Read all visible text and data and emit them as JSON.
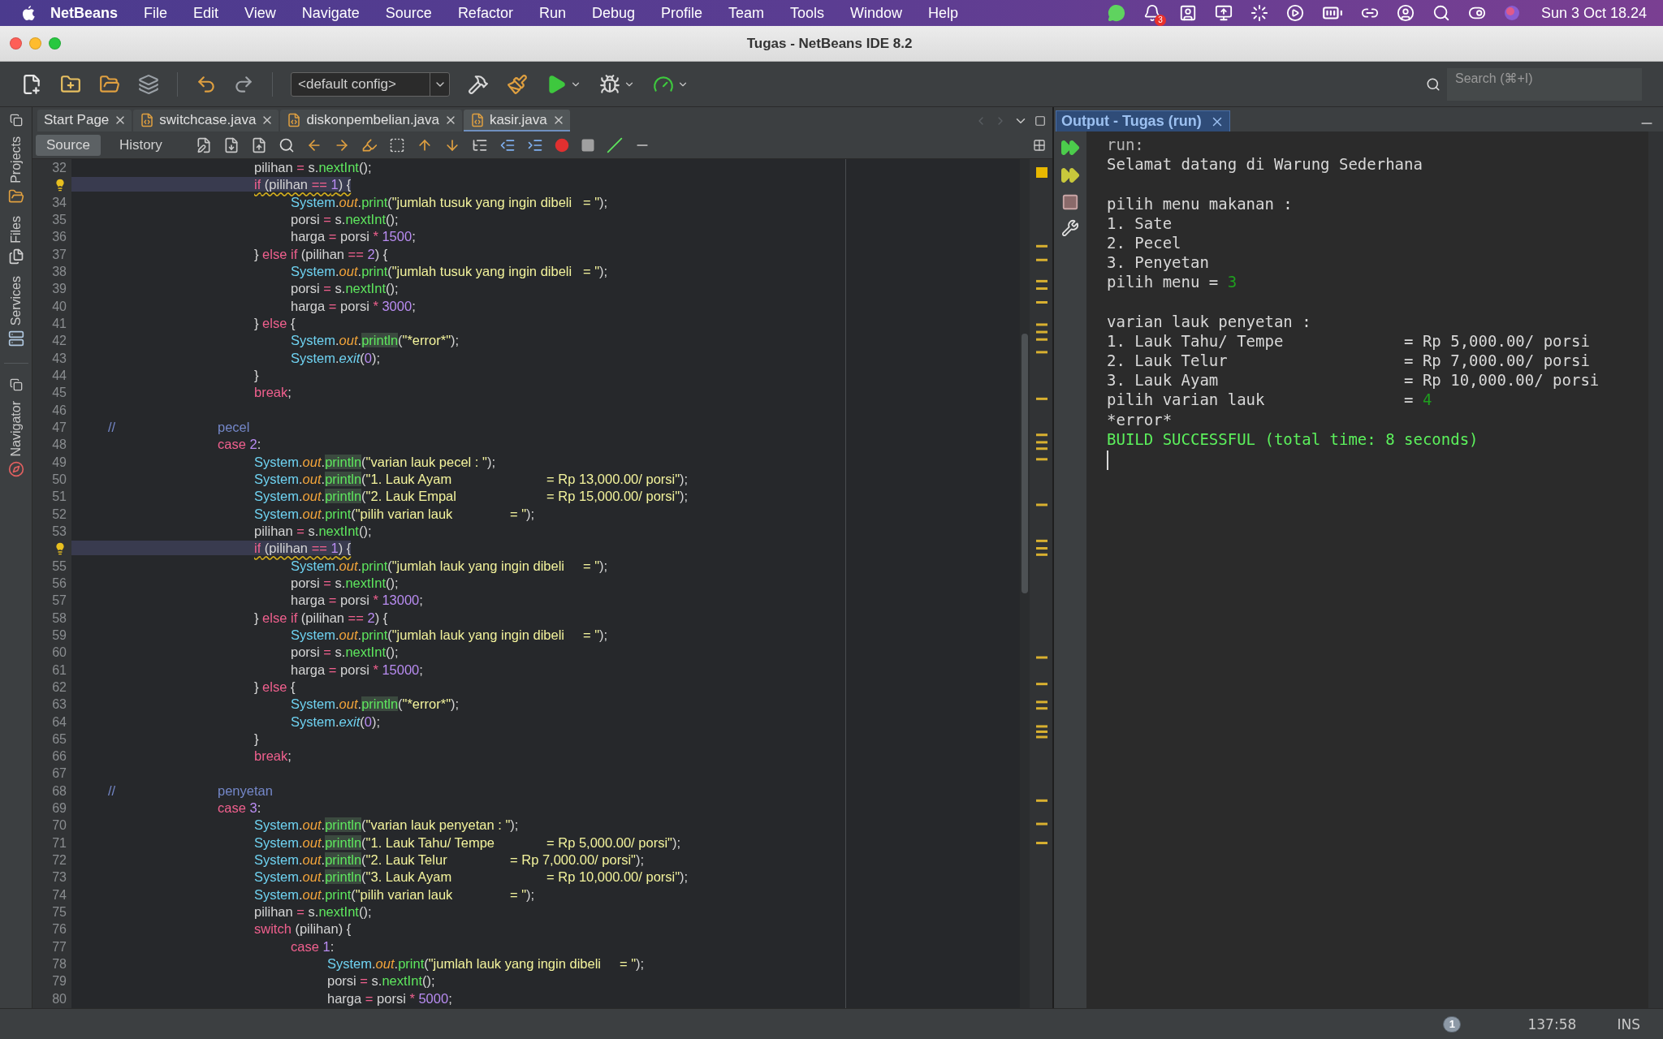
{
  "menubar": {
    "app": "NetBeans",
    "menus": [
      "File",
      "Edit",
      "View",
      "Navigate",
      "Source",
      "Refactor",
      "Run",
      "Debug",
      "Profile",
      "Team",
      "Tools",
      "Window",
      "Help"
    ],
    "badge": "3",
    "clock": "Sun 3 Oct  18.24"
  },
  "window": {
    "title": "Tugas - NetBeans IDE 8.2"
  },
  "toolbar": {
    "config": "<default config>",
    "search": {
      "placeholder": "Search (⌘+I)"
    }
  },
  "side_tabs_top": [
    {
      "label": "Projects",
      "kind": "projects"
    },
    {
      "label": "Files",
      "kind": "files"
    },
    {
      "label": "Services",
      "kind": "services"
    }
  ],
  "side_tabs_bottom": [
    {
      "label": "Navigator",
      "kind": "navigator"
    }
  ],
  "editor": {
    "tabs": [
      {
        "label": "Start Page",
        "kind": "page",
        "selected": false
      },
      {
        "label": "switchcase.java",
        "kind": "java",
        "selected": false
      },
      {
        "label": "diskonpembelian.java",
        "kind": "java",
        "selected": false
      },
      {
        "label": "kasir.java",
        "kind": "java",
        "selected": true
      }
    ],
    "view_tabs": [
      {
        "label": "Source",
        "selected": true
      },
      {
        "label": "History",
        "selected": false
      }
    ],
    "lines": [
      {
        "number": "32",
        "warning": false,
        "tokens": [
          {
            "kind": "p",
            "text": "\t\t\t\t\tpilihan "
          },
          {
            "kind": "op",
            "text": "= "
          },
          {
            "kind": "p",
            "text": "s."
          },
          {
            "kind": "m",
            "text": "nextInt"
          },
          {
            "kind": "p",
            "text": "();"
          }
        ]
      },
      {
        "warning": true,
        "tokens": [
          {
            "kind": "wkw",
            "text": "\t\t\t\t\tif"
          },
          {
            "kind": "wp",
            "text": " (pilihan "
          },
          {
            "kind": "wop",
            "text": "== "
          },
          {
            "kind": "wnum",
            "text": "1"
          },
          {
            "kind": "wp",
            "text": ") {"
          }
        ]
      },
      {
        "number": "34",
        "warning": false,
        "tokens": [
          {
            "kind": "sys",
            "text": "\t\t\t\t\t\tSystem"
          },
          {
            "kind": "p",
            "text": "."
          },
          {
            "kind": "field",
            "text": "out"
          },
          {
            "kind": "p",
            "text": "."
          },
          {
            "kind": "m",
            "text": "print"
          },
          {
            "kind": "p",
            "text": "("
          },
          {
            "kind": "str",
            "text": "\"jumlah tusuk yang ingin dibeli\t= \""
          },
          {
            "kind": "p",
            "text": ");"
          }
        ]
      },
      {
        "number": "35",
        "warning": false,
        "tokens": [
          {
            "kind": "p",
            "text": "\t\t\t\t\t\tporsi "
          },
          {
            "kind": "op",
            "text": "= "
          },
          {
            "kind": "p",
            "text": "s."
          },
          {
            "kind": "m",
            "text": "nextInt"
          },
          {
            "kind": "p",
            "text": "();"
          }
        ]
      },
      {
        "number": "36",
        "warning": false,
        "tokens": [
          {
            "kind": "p",
            "text": "\t\t\t\t\t\tharga "
          },
          {
            "kind": "op",
            "text": "= "
          },
          {
            "kind": "p",
            "text": "porsi "
          },
          {
            "kind": "op",
            "text": "* "
          },
          {
            "kind": "num",
            "text": "1500"
          },
          {
            "kind": "p",
            "text": ";"
          }
        ]
      },
      {
        "number": "37",
        "warning": false,
        "tokens": [
          {
            "kind": "p",
            "text": "\t\t\t\t\t} "
          },
          {
            "kind": "kw",
            "text": "else if"
          },
          {
            "kind": "p",
            "text": " (pilihan "
          },
          {
            "kind": "op",
            "text": "== "
          },
          {
            "kind": "num",
            "text": "2"
          },
          {
            "kind": "p",
            "text": ") {"
          }
        ]
      },
      {
        "number": "38",
        "warning": false,
        "tokens": [
          {
            "kind": "sys",
            "text": "\t\t\t\t\t\tSystem"
          },
          {
            "kind": "p",
            "text": "."
          },
          {
            "kind": "field",
            "text": "out"
          },
          {
            "kind": "p",
            "text": "."
          },
          {
            "kind": "m",
            "text": "print"
          },
          {
            "kind": "p",
            "text": "("
          },
          {
            "kind": "str",
            "text": "\"jumlah tusuk yang ingin dibeli\t= \""
          },
          {
            "kind": "p",
            "text": ");"
          }
        ]
      },
      {
        "number": "39",
        "warning": false,
        "tokens": [
          {
            "kind": "p",
            "text": "\t\t\t\t\t\tporsi "
          },
          {
            "kind": "op",
            "text": "= "
          },
          {
            "kind": "p",
            "text": "s."
          },
          {
            "kind": "m",
            "text": "nextInt"
          },
          {
            "kind": "p",
            "text": "();"
          }
        ]
      },
      {
        "number": "40",
        "warning": false,
        "tokens": [
          {
            "kind": "p",
            "text": "\t\t\t\t\t\tharga "
          },
          {
            "kind": "op",
            "text": "= "
          },
          {
            "kind": "p",
            "text": "porsi "
          },
          {
            "kind": "op",
            "text": "* "
          },
          {
            "kind": "num",
            "text": "3000"
          },
          {
            "kind": "p",
            "text": ";"
          }
        ]
      },
      {
        "number": "41",
        "warning": false,
        "tokens": [
          {
            "kind": "p",
            "text": "\t\t\t\t\t} "
          },
          {
            "kind": "kw",
            "text": "else"
          },
          {
            "kind": "p",
            "text": " {"
          }
        ]
      },
      {
        "number": "42",
        "warning": false,
        "tokens": [
          {
            "kind": "sys",
            "text": "\t\t\t\t\t\tSystem"
          },
          {
            "kind": "p",
            "text": "."
          },
          {
            "kind": "field",
            "text": "out"
          },
          {
            "kind": "p",
            "text": "."
          },
          {
            "kind": "hl",
            "text": "println"
          },
          {
            "kind": "p",
            "text": "("
          },
          {
            "kind": "str",
            "text": "\"*error*\""
          },
          {
            "kind": "p",
            "text": ");"
          }
        ]
      },
      {
        "number": "43",
        "warning": false,
        "tokens": [
          {
            "kind": "sys",
            "text": "\t\t\t\t\t\tSystem"
          },
          {
            "kind": "p",
            "text": "."
          },
          {
            "kind": "static",
            "text": "exit"
          },
          {
            "kind": "p",
            "text": "("
          },
          {
            "kind": "num",
            "text": "0"
          },
          {
            "kind": "p",
            "text": ");"
          }
        ]
      },
      {
        "number": "44",
        "warning": false,
        "tokens": [
          {
            "kind": "p",
            "text": "\t\t\t\t\t}"
          }
        ]
      },
      {
        "number": "45",
        "warning": false,
        "tokens": [
          {
            "kind": "kw",
            "text": "\t\t\t\t\tbreak"
          },
          {
            "kind": "p",
            "text": ";"
          }
        ]
      },
      {
        "number": "46",
        "warning": false
      },
      {
        "number": "47",
        "warning": false,
        "tokens": [
          {
            "kind": "cm",
            "text": "\t//\t\t\tpecel"
          }
        ]
      },
      {
        "number": "48",
        "warning": false,
        "tokens": [
          {
            "kind": "kw",
            "text": "\t\t\t\tcase "
          },
          {
            "kind": "num",
            "text": "2"
          },
          {
            "kind": "p",
            "text": ":"
          }
        ]
      },
      {
        "number": "49",
        "warning": false,
        "tokens": [
          {
            "kind": "sys",
            "text": "\t\t\t\t\tSystem"
          },
          {
            "kind": "p",
            "text": "."
          },
          {
            "kind": "field",
            "text": "out"
          },
          {
            "kind": "p",
            "text": "."
          },
          {
            "kind": "hl",
            "text": "println"
          },
          {
            "kind": "p",
            "text": "("
          },
          {
            "kind": "str",
            "text": "\"varian lauk pecel : \""
          },
          {
            "kind": "p",
            "text": ");"
          }
        ]
      },
      {
        "number": "50",
        "warning": false,
        "tokens": [
          {
            "kind": "sys",
            "text": "\t\t\t\t\tSystem"
          },
          {
            "kind": "p",
            "text": "."
          },
          {
            "kind": "field",
            "text": "out"
          },
          {
            "kind": "p",
            "text": "."
          },
          {
            "kind": "hl",
            "text": "println"
          },
          {
            "kind": "p",
            "text": "("
          },
          {
            "kind": "str",
            "text": "\"1. Lauk Ayam\t\t\t= Rp 13,000.00/ porsi\""
          },
          {
            "kind": "p",
            "text": ");"
          }
        ]
      },
      {
        "number": "51",
        "warning": false,
        "tokens": [
          {
            "kind": "sys",
            "text": "\t\t\t\t\tSystem"
          },
          {
            "kind": "p",
            "text": "."
          },
          {
            "kind": "field",
            "text": "out"
          },
          {
            "kind": "p",
            "text": "."
          },
          {
            "kind": "hl",
            "text": "println"
          },
          {
            "kind": "p",
            "text": "("
          },
          {
            "kind": "str",
            "text": "\"2. Lauk Empal\t\t\t= Rp 15,000.00/ porsi\""
          },
          {
            "kind": "p",
            "text": ");"
          }
        ]
      },
      {
        "number": "52",
        "warning": false,
        "tokens": [
          {
            "kind": "sys",
            "text": "\t\t\t\t\tSystem"
          },
          {
            "kind": "p",
            "text": "."
          },
          {
            "kind": "field",
            "text": "out"
          },
          {
            "kind": "p",
            "text": "."
          },
          {
            "kind": "m",
            "text": "print"
          },
          {
            "kind": "p",
            "text": "("
          },
          {
            "kind": "str",
            "text": "\"pilih varian lauk\t\t= \""
          },
          {
            "kind": "p",
            "text": ");"
          }
        ]
      },
      {
        "number": "53",
        "warning": false,
        "tokens": [
          {
            "kind": "p",
            "text": "\t\t\t\t\tpilihan "
          },
          {
            "kind": "op",
            "text": "= "
          },
          {
            "kind": "p",
            "text": "s."
          },
          {
            "kind": "m",
            "text": "nextInt"
          },
          {
            "kind": "p",
            "text": "();"
          }
        ]
      },
      {
        "warning": true,
        "tokens": [
          {
            "kind": "wkw",
            "text": "\t\t\t\t\tif"
          },
          {
            "kind": "wp",
            "text": " (pilihan "
          },
          {
            "kind": "wop",
            "text": "== "
          },
          {
            "kind": "wnum",
            "text": "1"
          },
          {
            "kind": "wp",
            "text": ") {"
          }
        ]
      },
      {
        "number": "55",
        "warning": false,
        "tokens": [
          {
            "kind": "sys",
            "text": "\t\t\t\t\t\tSystem"
          },
          {
            "kind": "p",
            "text": "."
          },
          {
            "kind": "field",
            "text": "out"
          },
          {
            "kind": "p",
            "text": "."
          },
          {
            "kind": "m",
            "text": "print"
          },
          {
            "kind": "p",
            "text": "("
          },
          {
            "kind": "str",
            "text": "\"jumlah lauk yang ingin dibeli\t= \""
          },
          {
            "kind": "p",
            "text": ");"
          }
        ]
      },
      {
        "number": "56",
        "warning": false,
        "tokens": [
          {
            "kind": "p",
            "text": "\t\t\t\t\t\tporsi "
          },
          {
            "kind": "op",
            "text": "= "
          },
          {
            "kind": "p",
            "text": "s."
          },
          {
            "kind": "m",
            "text": "nextInt"
          },
          {
            "kind": "p",
            "text": "();"
          }
        ]
      },
      {
        "number": "57",
        "warning": false,
        "tokens": [
          {
            "kind": "p",
            "text": "\t\t\t\t\t\tharga "
          },
          {
            "kind": "op",
            "text": "= "
          },
          {
            "kind": "p",
            "text": "porsi "
          },
          {
            "kind": "op",
            "text": "* "
          },
          {
            "kind": "num",
            "text": "13000"
          },
          {
            "kind": "p",
            "text": ";"
          }
        ]
      },
      {
        "number": "58",
        "warning": false,
        "tokens": [
          {
            "kind": "p",
            "text": "\t\t\t\t\t} "
          },
          {
            "kind": "kw",
            "text": "else if"
          },
          {
            "kind": "p",
            "text": " (pilihan "
          },
          {
            "kind": "op",
            "text": "== "
          },
          {
            "kind": "num",
            "text": "2"
          },
          {
            "kind": "p",
            "text": ") {"
          }
        ]
      },
      {
        "number": "59",
        "warning": false,
        "tokens": [
          {
            "kind": "sys",
            "text": "\t\t\t\t\t\tSystem"
          },
          {
            "kind": "p",
            "text": "."
          },
          {
            "kind": "field",
            "text": "out"
          },
          {
            "kind": "p",
            "text": "."
          },
          {
            "kind": "m",
            "text": "print"
          },
          {
            "kind": "p",
            "text": "("
          },
          {
            "kind": "str",
            "text": "\"jumlah lauk yang ingin dibeli\t= \""
          },
          {
            "kind": "p",
            "text": ");"
          }
        ]
      },
      {
        "number": "60",
        "warning": false,
        "tokens": [
          {
            "kind": "p",
            "text": "\t\t\t\t\t\tporsi "
          },
          {
            "kind": "op",
            "text": "= "
          },
          {
            "kind": "p",
            "text": "s."
          },
          {
            "kind": "m",
            "text": "nextInt"
          },
          {
            "kind": "p",
            "text": "();"
          }
        ]
      },
      {
        "number": "61",
        "warning": false,
        "tokens": [
          {
            "kind": "p",
            "text": "\t\t\t\t\t\tharga "
          },
          {
            "kind": "op",
            "text": "= "
          },
          {
            "kind": "p",
            "text": "porsi "
          },
          {
            "kind": "op",
            "text": "* "
          },
          {
            "kind": "num",
            "text": "15000"
          },
          {
            "kind": "p",
            "text": ";"
          }
        ]
      },
      {
        "number": "62",
        "warning": false,
        "tokens": [
          {
            "kind": "p",
            "text": "\t\t\t\t\t} "
          },
          {
            "kind": "kw",
            "text": "else"
          },
          {
            "kind": "p",
            "text": " {"
          }
        ]
      },
      {
        "number": "63",
        "warning": false,
        "tokens": [
          {
            "kind": "sys",
            "text": "\t\t\t\t\t\tSystem"
          },
          {
            "kind": "p",
            "text": "."
          },
          {
            "kind": "field",
            "text": "out"
          },
          {
            "kind": "p",
            "text": "."
          },
          {
            "kind": "hl",
            "text": "println"
          },
          {
            "kind": "p",
            "text": "("
          },
          {
            "kind": "str",
            "text": "\"*error*\""
          },
          {
            "kind": "p",
            "text": ");"
          }
        ]
      },
      {
        "number": "64",
        "warning": false,
        "tokens": [
          {
            "kind": "sys",
            "text": "\t\t\t\t\t\tSystem"
          },
          {
            "kind": "p",
            "text": "."
          },
          {
            "kind": "static",
            "text": "exit"
          },
          {
            "kind": "p",
            "text": "("
          },
          {
            "kind": "num",
            "text": "0"
          },
          {
            "kind": "p",
            "text": ");"
          }
        ]
      },
      {
        "number": "65",
        "warning": false,
        "tokens": [
          {
            "kind": "p",
            "text": "\t\t\t\t\t}"
          }
        ]
      },
      {
        "number": "66",
        "warning": false,
        "tokens": [
          {
            "kind": "kw",
            "text": "\t\t\t\t\tbreak"
          },
          {
            "kind": "p",
            "text": ";"
          }
        ]
      },
      {
        "number": "67",
        "warning": false
      },
      {
        "number": "68",
        "warning": false,
        "tokens": [
          {
            "kind": "cm",
            "text": "\t//\t\t\tpenyetan"
          }
        ]
      },
      {
        "number": "69",
        "warning": false,
        "tokens": [
          {
            "kind": "kw",
            "text": "\t\t\t\tcase "
          },
          {
            "kind": "num",
            "text": "3"
          },
          {
            "kind": "p",
            "text": ":"
          }
        ]
      },
      {
        "number": "70",
        "warning": false,
        "tokens": [
          {
            "kind": "sys",
            "text": "\t\t\t\t\tSystem"
          },
          {
            "kind": "p",
            "text": "."
          },
          {
            "kind": "field",
            "text": "out"
          },
          {
            "kind": "p",
            "text": "."
          },
          {
            "kind": "hl",
            "text": "println"
          },
          {
            "kind": "p",
            "text": "("
          },
          {
            "kind": "str",
            "text": "\"varian lauk penyetan : \""
          },
          {
            "kind": "p",
            "text": ");"
          }
        ]
      },
      {
        "number": "71",
        "warning": false,
        "tokens": [
          {
            "kind": "sys",
            "text": "\t\t\t\t\tSystem"
          },
          {
            "kind": "p",
            "text": "."
          },
          {
            "kind": "field",
            "text": "out"
          },
          {
            "kind": "p",
            "text": "."
          },
          {
            "kind": "hl",
            "text": "println"
          },
          {
            "kind": "p",
            "text": "("
          },
          {
            "kind": "str",
            "text": "\"1. Lauk Tahu/ Tempe\t\t= Rp 5,000.00/ porsi\""
          },
          {
            "kind": "p",
            "text": ");"
          }
        ]
      },
      {
        "number": "72",
        "warning": false,
        "tokens": [
          {
            "kind": "sys",
            "text": "\t\t\t\t\tSystem"
          },
          {
            "kind": "p",
            "text": "."
          },
          {
            "kind": "field",
            "text": "out"
          },
          {
            "kind": "p",
            "text": "."
          },
          {
            "kind": "hl",
            "text": "println"
          },
          {
            "kind": "p",
            "text": "("
          },
          {
            "kind": "str",
            "text": "\"2. Lauk Telur\t\t= Rp 7,000.00/ porsi\""
          },
          {
            "kind": "p",
            "text": ");"
          }
        ]
      },
      {
        "number": "73",
        "warning": false,
        "tokens": [
          {
            "kind": "sys",
            "text": "\t\t\t\t\tSystem"
          },
          {
            "kind": "p",
            "text": "."
          },
          {
            "kind": "field",
            "text": "out"
          },
          {
            "kind": "p",
            "text": "."
          },
          {
            "kind": "hl",
            "text": "println"
          },
          {
            "kind": "p",
            "text": "("
          },
          {
            "kind": "str",
            "text": "\"3. Lauk Ayam\t\t\t= Rp 10,000.00/ porsi\""
          },
          {
            "kind": "p",
            "text": ");"
          }
        ]
      },
      {
        "number": "74",
        "warning": false,
        "tokens": [
          {
            "kind": "sys",
            "text": "\t\t\t\t\tSystem"
          },
          {
            "kind": "p",
            "text": "."
          },
          {
            "kind": "field",
            "text": "out"
          },
          {
            "kind": "p",
            "text": "."
          },
          {
            "kind": "m",
            "text": "print"
          },
          {
            "kind": "p",
            "text": "("
          },
          {
            "kind": "str",
            "text": "\"pilih varian lauk\t\t= \""
          },
          {
            "kind": "p",
            "text": ");"
          }
        ]
      },
      {
        "number": "75",
        "warning": false,
        "tokens": [
          {
            "kind": "p",
            "text": "\t\t\t\t\tpilihan "
          },
          {
            "kind": "op",
            "text": "= "
          },
          {
            "kind": "p",
            "text": "s."
          },
          {
            "kind": "m",
            "text": "nextInt"
          },
          {
            "kind": "p",
            "text": "();"
          }
        ]
      },
      {
        "number": "76",
        "warning": false,
        "tokens": [
          {
            "kind": "kw",
            "text": "\t\t\t\t\tswitch"
          },
          {
            "kind": "p",
            "text": " (pilihan) {"
          }
        ]
      },
      {
        "number": "77",
        "warning": false,
        "tokens": [
          {
            "kind": "kw",
            "text": "\t\t\t\t\t\tcase "
          },
          {
            "kind": "num",
            "text": "1"
          },
          {
            "kind": "p",
            "text": ":"
          }
        ]
      },
      {
        "number": "78",
        "warning": false,
        "tokens": [
          {
            "kind": "sys",
            "text": "\t\t\t\t\t\t\tSystem"
          },
          {
            "kind": "p",
            "text": "."
          },
          {
            "kind": "field",
            "text": "out"
          },
          {
            "kind": "p",
            "text": "."
          },
          {
            "kind": "m",
            "text": "print"
          },
          {
            "kind": "p",
            "text": "("
          },
          {
            "kind": "str",
            "text": "\"jumlah lauk yang ingin dibeli\t= \""
          },
          {
            "kind": "p",
            "text": ");"
          }
        ]
      },
      {
        "number": "79",
        "warning": false,
        "tokens": [
          {
            "kind": "p",
            "text": "\t\t\t\t\t\t\tporsi "
          },
          {
            "kind": "op",
            "text": "= "
          },
          {
            "kind": "p",
            "text": "s."
          },
          {
            "kind": "m",
            "text": "nextInt"
          },
          {
            "kind": "p",
            "text": "();"
          }
        ]
      },
      {
        "number": "80",
        "warning": false,
        "tokens": [
          {
            "kind": "p",
            "text": "\t\t\t\t\t\t\tharga "
          },
          {
            "kind": "op",
            "text": "= "
          },
          {
            "kind": "p",
            "text": "porsi "
          },
          {
            "kind": "op",
            "text": "* "
          },
          {
            "kind": "num",
            "text": "5000"
          },
          {
            "kind": "p",
            "text": ";"
          }
        ]
      }
    ]
  },
  "output": {
    "tab": {
      "label": "Output - Tugas (run)",
      "selected": true
    },
    "blocks": [
      [
        [
          {
            "kind": "info",
            "text": "run:"
          }
        ],
        [
          {
            "kind": "o",
            "text": "Selamat datang di Warung Sederhana"
          }
        ]
      ],
      [
        [
          {
            "kind": "o",
            "text": "pilih menu makanan :"
          }
        ],
        [
          {
            "kind": "o",
            "text": "1. Sate"
          }
        ],
        [
          {
            "kind": "o",
            "text": "2. Pecel"
          }
        ],
        [
          {
            "kind": "o",
            "text": "3. Penyetan"
          }
        ],
        [
          {
            "kind": "o",
            "text": "pilih menu = "
          },
          {
            "kind": "in",
            "text": "3"
          }
        ]
      ],
      [
        [
          {
            "kind": "o",
            "text": "varian lauk penyetan :"
          }
        ],
        [
          {
            "kind": "o",
            "text": "1. Lauk Tahu/ Tempe             = Rp 5,000.00/ porsi"
          }
        ],
        [
          {
            "kind": "o",
            "text": "2. Lauk Telur                   = Rp 7,000.00/ porsi"
          }
        ],
        [
          {
            "kind": "o",
            "text": "3. Lauk Ayam                    = Rp 10,000.00/ porsi"
          }
        ],
        [
          {
            "kind": "o",
            "text": "pilih varian lauk               = "
          },
          {
            "kind": "in",
            "text": "4"
          }
        ],
        [
          {
            "kind": "o",
            "text": "*error*"
          }
        ],
        [
          {
            "kind": "ok",
            "text": "BUILD SUCCESSFUL (total time: 8 seconds)"
          }
        ]
      ]
    ]
  },
  "status_bar": {
    "notifications": "1",
    "position": "137:58",
    "mode": "INS"
  }
}
